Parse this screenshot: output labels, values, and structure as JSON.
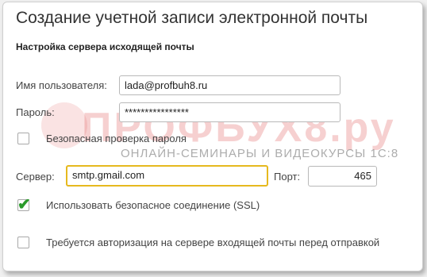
{
  "dialog": {
    "title": "Создание учетной записи электронной почты",
    "section_title": "Настройка сервера исходящей почты"
  },
  "form": {
    "username_label": "Имя пользователя:",
    "username_value": "lada@profbuh8.ru",
    "password_label": "Пароль:",
    "password_value": "****************",
    "secure_password_label": "Безопасная проверка пароля",
    "secure_password_checked": false,
    "server_label": "Сервер:",
    "server_value": "smtp.gmail.com",
    "port_label": "Порт:",
    "port_value": "465",
    "ssl_label": "Использовать безопасное соединение (SSL)",
    "ssl_checked": true,
    "auth_label": "Требуется авторизация на сервере входящей почты перед отправкой",
    "auth_checked": false
  },
  "watermark": {
    "main": "ПРОФБУХ8.ру",
    "sub": "ОНЛАЙН-СЕМИНАРЫ И ВИДЕОКУРСЫ 1С:8"
  },
  "colors": {
    "focus_border": "#e6b91e",
    "checkmark": "#2a9a2a",
    "watermark": "#d93a3a"
  }
}
